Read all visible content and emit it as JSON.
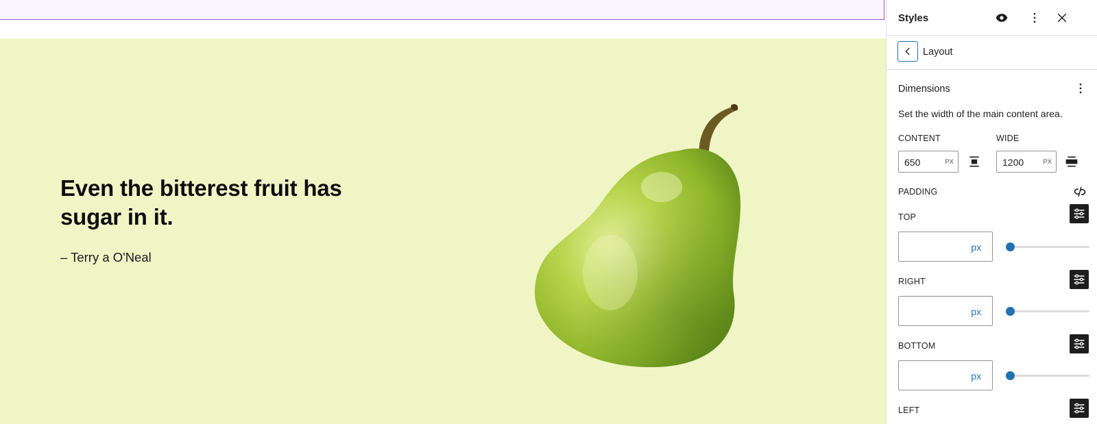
{
  "canvas": {
    "quote": "Even the bitterest fruit has sugar in it.",
    "citation": "– Terry a O'Neal",
    "cover_color": "#f0f5c6",
    "image_icon": "pear-illustration"
  },
  "sidebar": {
    "title": "Styles",
    "header_icons": [
      "eye-icon",
      "more-vertical-icon",
      "close-icon"
    ],
    "nav": {
      "title": "Layout"
    },
    "dimensions": {
      "title": "Dimensions",
      "description": "Set the width of the main content area.",
      "content": {
        "label": "CONTENT",
        "value": "650",
        "unit": "PX"
      },
      "wide": {
        "label": "WIDE",
        "value": "1200",
        "unit": "PX"
      }
    },
    "padding": {
      "label": "PADDING",
      "top": {
        "label": "TOP",
        "value": "",
        "unit": "px",
        "slider": 0
      },
      "right": {
        "label": "RIGHT",
        "value": "",
        "unit": "px",
        "slider": 0
      },
      "bottom": {
        "label": "BOTTOM",
        "value": "",
        "unit": "px",
        "slider": 0
      },
      "left": {
        "label": "LEFT"
      }
    },
    "accent_color": "#2271b1"
  }
}
